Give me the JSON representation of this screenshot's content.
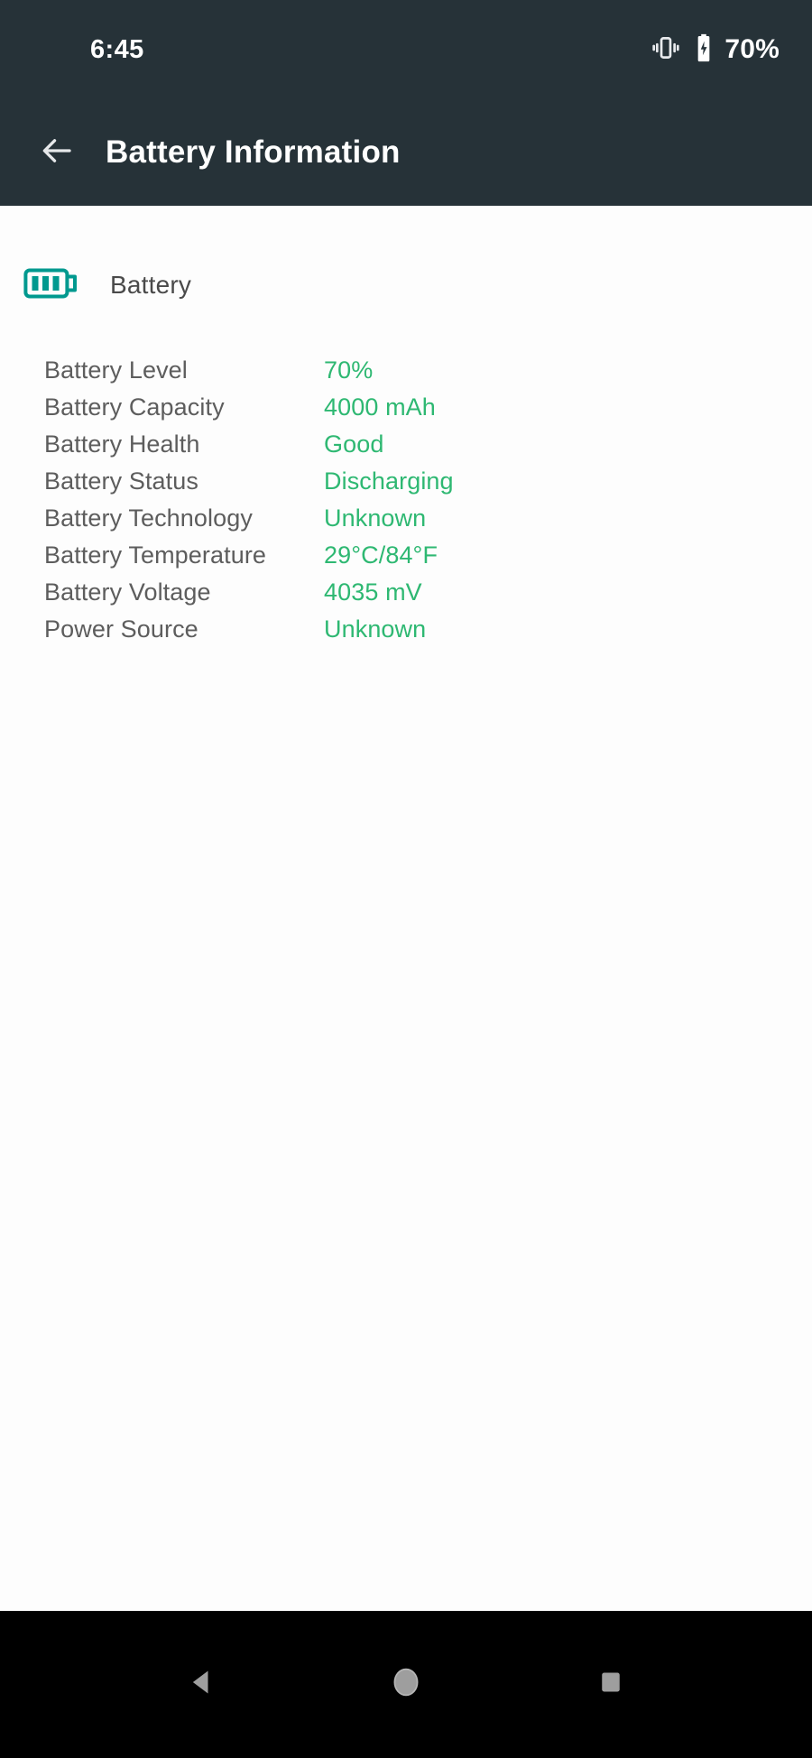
{
  "status_bar": {
    "time": "6:45",
    "vibrate_icon": "vibrate-icon",
    "battery_icon": "battery-icon",
    "battery_percent": "70%"
  },
  "app_bar": {
    "back_icon": "arrow-left-icon",
    "title": "Battery Information"
  },
  "section": {
    "icon": "battery-full-icon",
    "title": "Battery"
  },
  "info_rows": [
    {
      "label": "Battery Level",
      "value": "70%"
    },
    {
      "label": "Battery Capacity",
      "value": "4000 mAh"
    },
    {
      "label": "Battery Health",
      "value": "Good"
    },
    {
      "label": "Battery Status",
      "value": "Discharging"
    },
    {
      "label": "Battery Technology",
      "value": "Unknown"
    },
    {
      "label": "Battery Temperature",
      "value": "29°C/84°F"
    },
    {
      "label": "Battery Voltage",
      "value": "4035 mV"
    },
    {
      "label": "Power Source",
      "value": "Unknown"
    }
  ],
  "nav_bar": {
    "back": "triangle-back-icon",
    "home": "circle-home-icon",
    "recents": "square-recents-icon"
  },
  "colors": {
    "app_bar_bg": "#263238",
    "accent_teal": "#00998F",
    "value_green": "#2eb872",
    "label_gray": "#5d5d5d",
    "nav_bg": "#000000",
    "content_bg": "#fdfdfd"
  }
}
